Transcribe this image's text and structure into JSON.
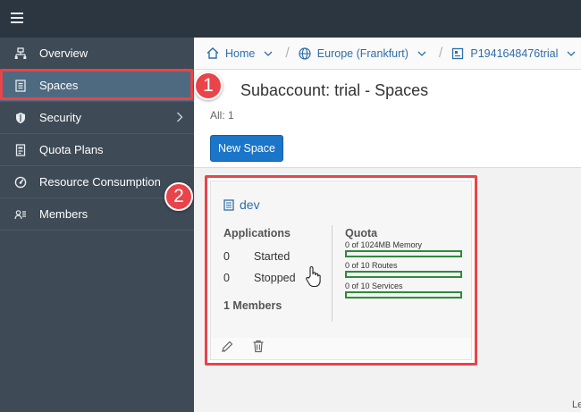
{
  "sidebar": {
    "items": [
      {
        "label": "Overview",
        "icon": "overview-icon"
      },
      {
        "label": "Spaces",
        "icon": "spaces-icon",
        "active": true
      },
      {
        "label": "Security",
        "icon": "shield-icon",
        "has_submenu": true
      },
      {
        "label": "Quota Plans",
        "icon": "quota-plans-icon"
      },
      {
        "label": "Resource Consumption",
        "icon": "gauge-icon"
      },
      {
        "label": "Members",
        "icon": "members-icon"
      }
    ]
  },
  "breadcrumb": {
    "home": "Home",
    "region": "Europe (Frankfurt)",
    "account": "P1941648476trial"
  },
  "header": {
    "title": "Subaccount: trial - Spaces",
    "count": "All: 1",
    "new_space_label": "New Space"
  },
  "annotations": {
    "badge1": "1",
    "badge2": "2"
  },
  "space_card": {
    "name": "dev",
    "applications_title": "Applications",
    "started": {
      "count": "0",
      "label": "Started"
    },
    "stopped": {
      "count": "0",
      "label": "Stopped"
    },
    "members": "1 Members",
    "quota_title": "Quota",
    "quotas": [
      {
        "label": "0 of 1024MB Memory",
        "used_fraction": 0
      },
      {
        "label": "0 of 10 Routes",
        "used_fraction": 0
      },
      {
        "label": "0 of 10 Services",
        "used_fraction": 0
      }
    ]
  },
  "corner_text": "Le",
  "colors": {
    "topbar": "#2c3640",
    "sidebar": "#3e4a55",
    "active_item": "#4e6a80",
    "primary_button": "#1b75c9",
    "link": "#2f6ea8",
    "highlight": "#e8444a",
    "quota_bar": "#2e8b3a"
  }
}
